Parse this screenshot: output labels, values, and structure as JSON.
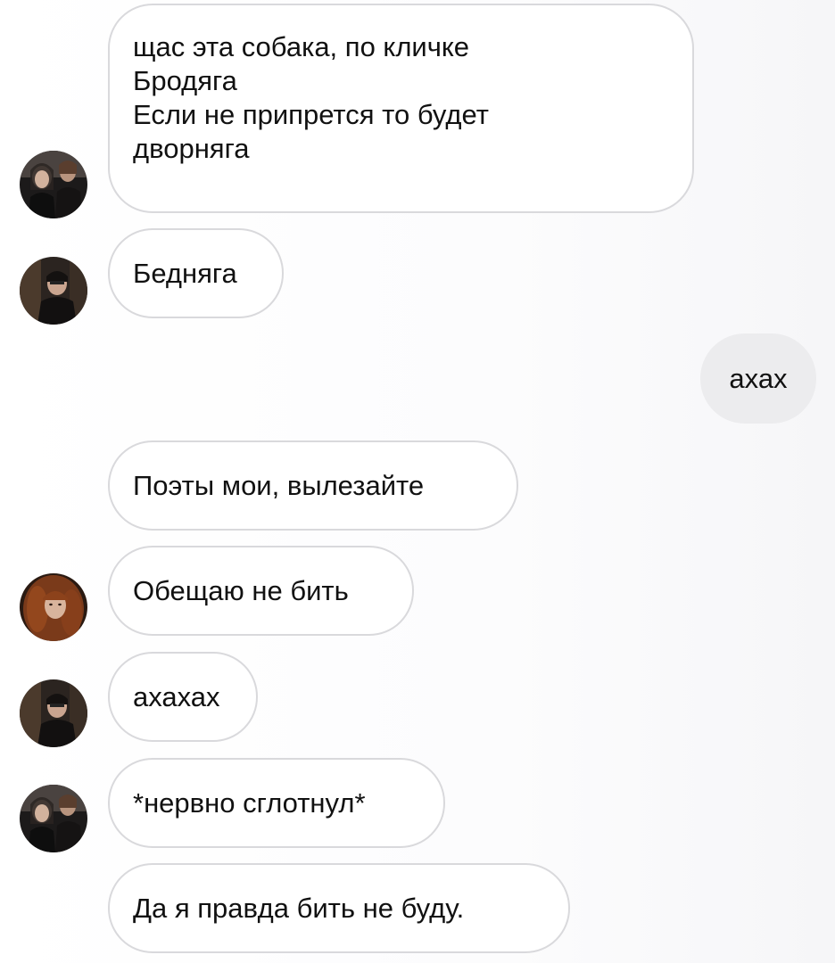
{
  "conversation": {
    "messages": [
      {
        "sender": "incoming",
        "avatar": "dark-couple-avatar",
        "lines": [
          "щас эта собака, по кличке",
          "Бродяга",
          "Если не припрется то будет",
          "дворняга"
        ]
      },
      {
        "sender": "incoming",
        "avatar": "dark-hair-boy-avatar",
        "text": "Бедняга"
      },
      {
        "sender": "outgoing",
        "text": "ахах"
      },
      {
        "sender": "incoming",
        "avatar": "",
        "text": "Поэты мои, вылезайте"
      },
      {
        "sender": "incoming",
        "avatar": "red-hair-girl-avatar",
        "text": "Обещаю не бить"
      },
      {
        "sender": "incoming",
        "avatar": "dark-hair-boy-avatar",
        "text": "ахахах"
      },
      {
        "sender": "incoming",
        "avatar": "dark-couple-avatar",
        "text": "*нервно сглотнул*"
      },
      {
        "sender": "incoming",
        "avatar": "",
        "text": "Да я правда бить не буду."
      }
    ]
  },
  "colors": {
    "incoming_bubble_bg": "#ffffff",
    "incoming_bubble_border": "#d9d9dc",
    "outgoing_bubble_bg": "#ececee",
    "text": "#111111"
  }
}
